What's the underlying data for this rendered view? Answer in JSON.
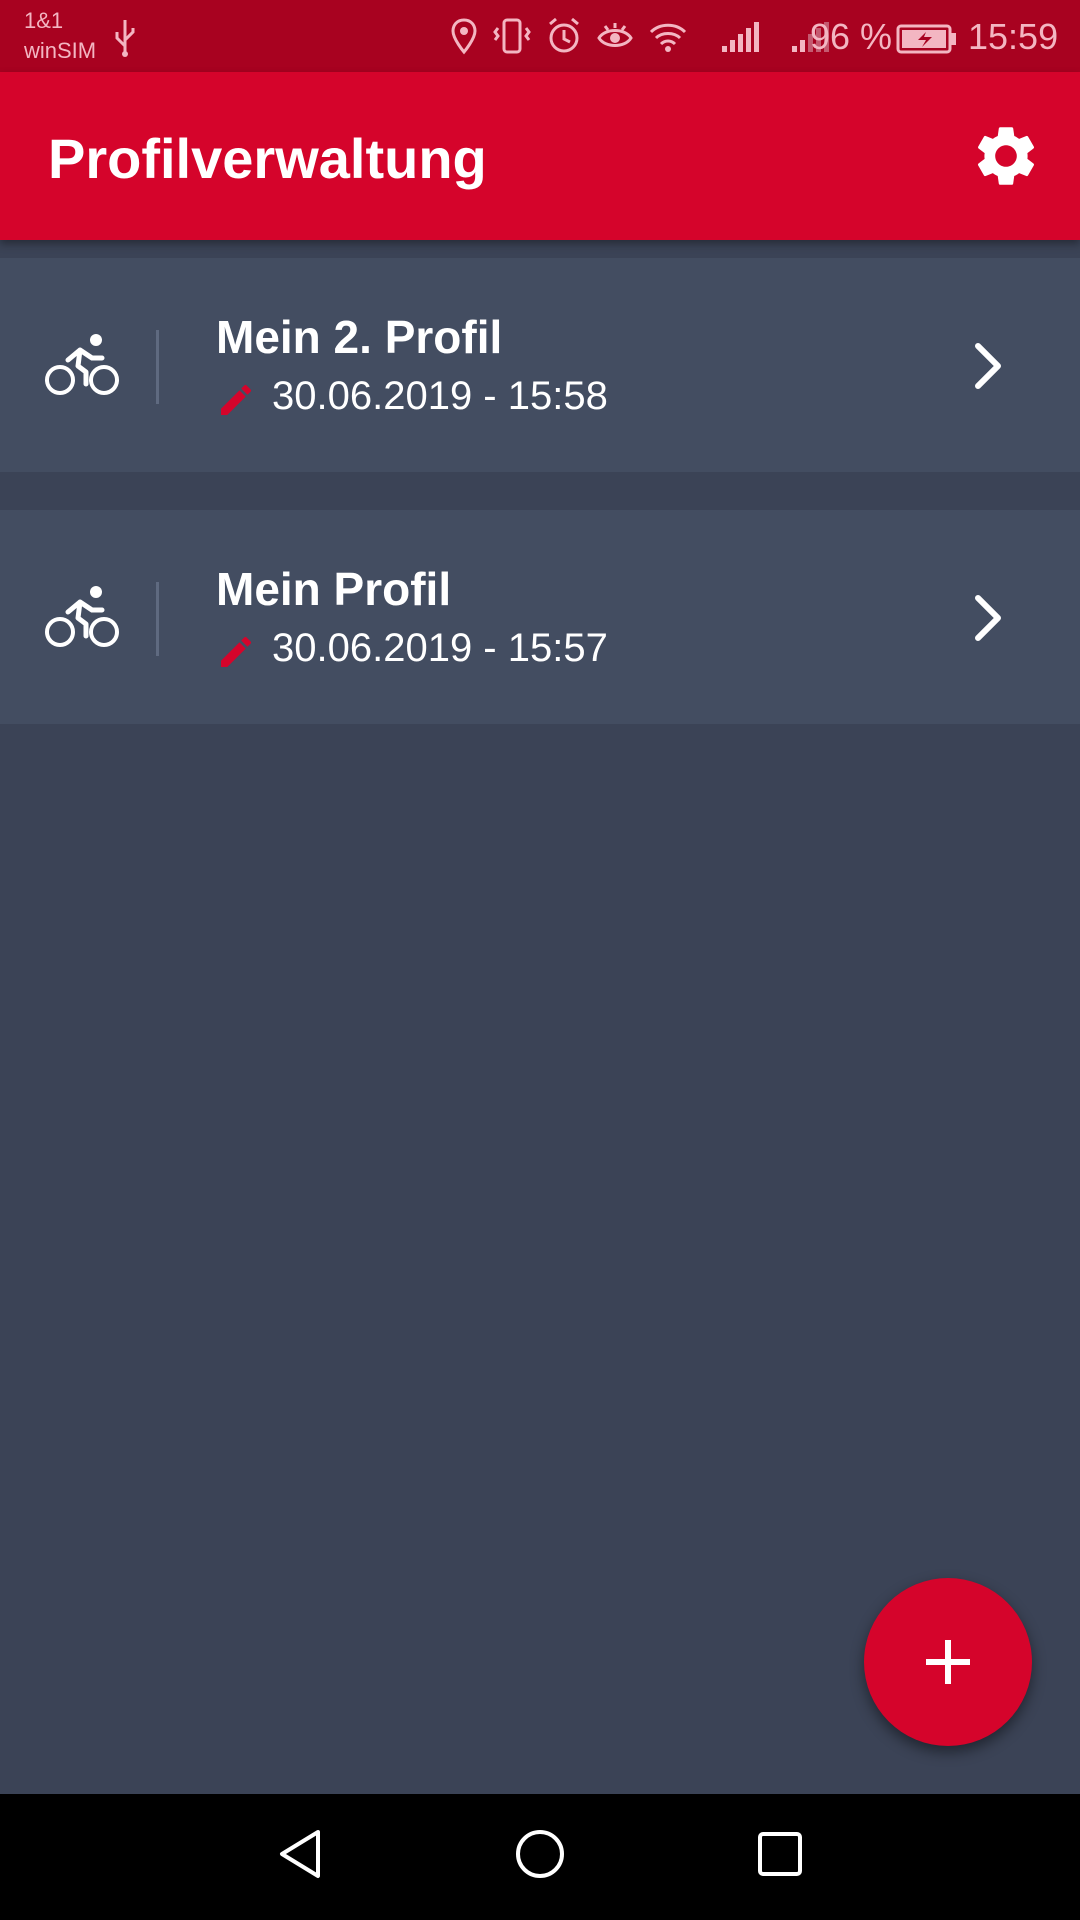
{
  "status_bar": {
    "carrier_line1": "1&1",
    "carrier_line2": "winSIM",
    "battery_percent": "96 %",
    "time": "15:59",
    "icons": [
      "usb-icon",
      "location-icon",
      "vibrate-icon",
      "alarm-icon",
      "eye-icon",
      "wifi-icon",
      "signal-icon",
      "signal-icon-2",
      "battery-charging-icon"
    ]
  },
  "app_bar": {
    "title": "Profilverwaltung",
    "settings_icon": "gear-icon"
  },
  "profiles": [
    {
      "name": "Mein 2. Profil",
      "modified": "30.06.2019 - 15:58",
      "icon": "bike-icon"
    },
    {
      "name": "Mein Profil",
      "modified": "30.06.2019 - 15:57",
      "icon": "bike-icon"
    }
  ],
  "fab": {
    "icon": "plus-icon"
  },
  "colors": {
    "primary": "#d5042b",
    "status_bar": "#a80220",
    "background": "#3b4356",
    "card": "#434d61"
  }
}
